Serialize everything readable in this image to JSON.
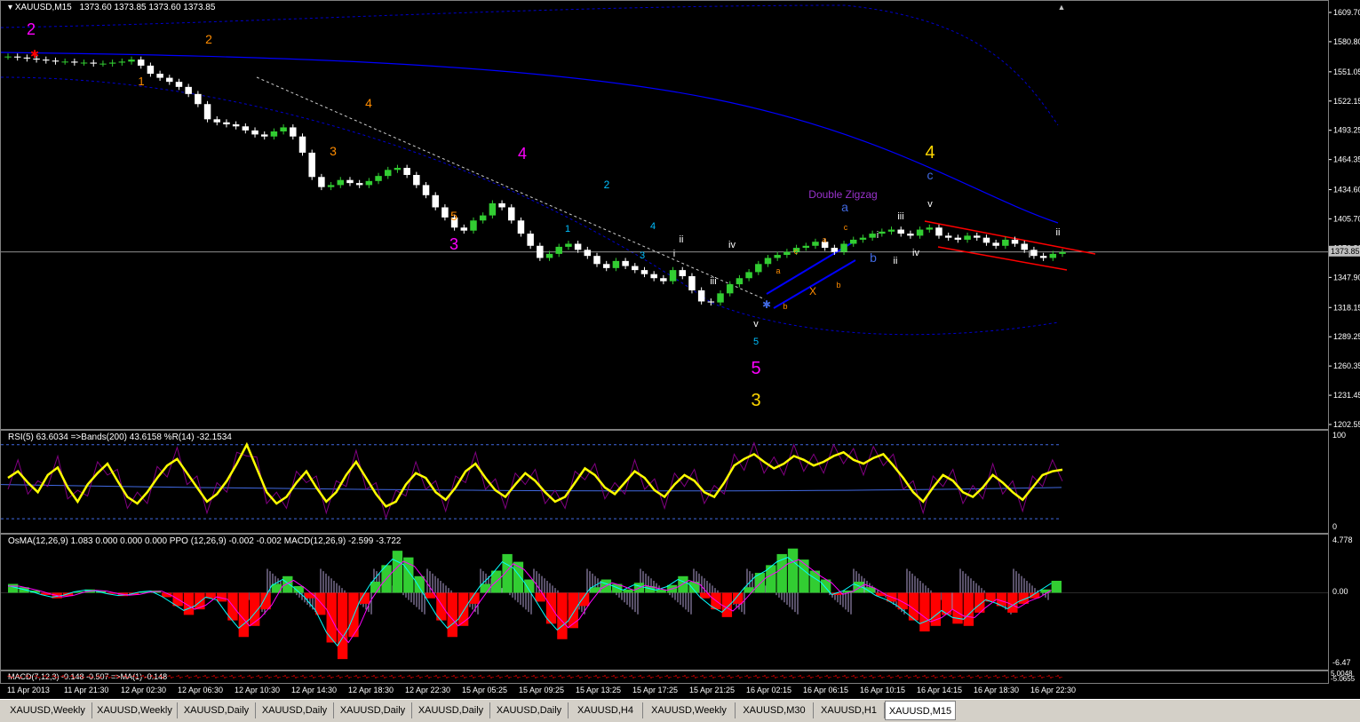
{
  "chart_data": [
    {
      "type": "candlestick",
      "symbol_title": "XAUUSD,M15",
      "ohlc_header": "1373.60 1373.85 1373.60 1373.85",
      "current_price_label": "1373.85",
      "ylim": [
        1202.55,
        1609.7
      ],
      "price_ticks": [
        "1609.70",
        "1580.80",
        "1551.05",
        "1522.15",
        "1493.25",
        "1464.35",
        "1434.60",
        "1405.70",
        "1376.80",
        "1347.90",
        "1318.15",
        "1289.25",
        "1260.35",
        "1231.45",
        "1202.55"
      ],
      "time_ticks": [
        "11 Apr 2013",
        "11 Apr 21:30",
        "12 Apr 02:30",
        "12 Apr 06:30",
        "12 Apr 10:30",
        "12 Apr 14:30",
        "12 Apr 18:30",
        "12 Apr 22:30",
        "15 Apr 05:25",
        "15 Apr 09:25",
        "15 Apr 13:25",
        "15 Apr 17:25",
        "15 Apr 21:25",
        "16 Apr 02:15",
        "16 Apr 06:15",
        "16 Apr 10:15",
        "16 Apr 14:15",
        "16 Apr 18:30",
        "16 Apr 22:30"
      ],
      "close_path": [
        1567,
        1566,
        1565,
        1564,
        1563,
        1562,
        1562,
        1561,
        1561,
        1560,
        1560,
        1561,
        1562,
        1564,
        1558,
        1550,
        1546,
        1542,
        1537,
        1530,
        1520,
        1505,
        1502,
        1500,
        1498,
        1494,
        1490,
        1488,
        1493,
        1497,
        1488,
        1472,
        1448,
        1438,
        1440,
        1445,
        1442,
        1440,
        1444,
        1449,
        1455,
        1457,
        1450,
        1440,
        1430,
        1418,
        1408,
        1398,
        1395,
        1405,
        1410,
        1422,
        1418,
        1405,
        1392,
        1380,
        1368,
        1372,
        1379,
        1382,
        1376,
        1370,
        1362,
        1358,
        1365,
        1360,
        1356,
        1352,
        1348,
        1345,
        1356,
        1350,
        1336,
        1325,
        1324,
        1333,
        1342,
        1348,
        1354,
        1362,
        1368,
        1371,
        1374,
        1378,
        1380,
        1384,
        1378,
        1374,
        1382,
        1386,
        1388,
        1392,
        1394,
        1396,
        1392,
        1390,
        1396,
        1398,
        1390,
        1388,
        1386,
        1390,
        1388,
        1383,
        1380,
        1386,
        1382,
        1376,
        1370,
        1368,
        1372,
        1373.85
      ],
      "current_price": 1373.85,
      "wave_labels": [
        {
          "text": "2",
          "color": "#ff00ff"
        },
        {
          "text": "2",
          "color": "#ff8c00"
        },
        {
          "text": "1",
          "color": "#ff8c00"
        },
        {
          "text": "4",
          "color": "#ff8c00"
        },
        {
          "text": "3",
          "color": "#ff8c00"
        },
        {
          "text": "5",
          "color": "#ff8c00"
        },
        {
          "text": "3",
          "color": "#ff00ff"
        },
        {
          "text": "4",
          "color": "#ff00ff"
        },
        {
          "text": "2",
          "color": "#00bfff"
        },
        {
          "text": "1",
          "color": "#00bfff"
        },
        {
          "text": "4",
          "color": "#00bfff"
        },
        {
          "text": "3",
          "color": "#00bfff"
        },
        {
          "text": "ii",
          "color": "#ffffff"
        },
        {
          "text": "i",
          "color": "#ffffff"
        },
        {
          "text": "iv",
          "color": "#ffffff"
        },
        {
          "text": "iii",
          "color": "#ffffff"
        },
        {
          "text": "v",
          "color": "#ffffff"
        },
        {
          "text": "5",
          "color": "#00bfff"
        },
        {
          "text": "5",
          "color": "#ff00ff"
        },
        {
          "text": "3",
          "color": "#ffd700"
        },
        {
          "text": "a",
          "color": "#ff8c00"
        },
        {
          "text": "b",
          "color": "#ff8c00"
        },
        {
          "text": "c",
          "color": "#ff8c00"
        },
        {
          "text": "X",
          "color": "#ff8c00"
        },
        {
          "text": "a",
          "color": "#ff8c00"
        },
        {
          "text": "b",
          "color": "#ff8c00"
        },
        {
          "text": "c",
          "color": "#ff8c00"
        },
        {
          "text": "a",
          "color": "#4169e1"
        },
        {
          "text": "Double Zigzag",
          "color": "#9932cc"
        },
        {
          "text": "b",
          "color": "#4169e1"
        },
        {
          "text": "i",
          "color": "#ffffff"
        },
        {
          "text": "ii",
          "color": "#ffffff"
        },
        {
          "text": "iii",
          "color": "#ffffff"
        },
        {
          "text": "iv",
          "color": "#ffffff"
        },
        {
          "text": "v",
          "color": "#ffffff"
        },
        {
          "text": "c",
          "color": "#4169e1"
        },
        {
          "text": "4",
          "color": "#ffd700"
        },
        {
          "text": "i",
          "color": "#ffffff"
        },
        {
          "text": "ii",
          "color": "#ffffff"
        }
      ]
    },
    {
      "type": "line",
      "title": "RSI(5) 63.6034  =>Bands(200) 43.6158  %R(14) -32.1534",
      "ylim": [
        0,
        100
      ],
      "y_ticks": [
        "100",
        "0"
      ],
      "rsi": [
        55,
        62,
        50,
        40,
        58,
        66,
        45,
        30,
        48,
        60,
        70,
        52,
        35,
        28,
        40,
        55,
        68,
        75,
        60,
        45,
        30,
        38,
        52,
        70,
        90,
        65,
        40,
        28,
        35,
        50,
        62,
        45,
        30,
        40,
        58,
        72,
        55,
        38,
        25,
        30,
        48,
        60,
        55,
        40,
        32,
        45,
        62,
        70,
        55,
        42,
        35,
        48,
        60,
        52,
        40,
        30,
        35,
        50,
        65,
        58,
        45,
        38,
        50,
        62,
        55,
        42,
        35,
        48,
        58,
        52,
        40,
        35,
        50,
        68,
        75,
        80,
        72,
        65,
        70,
        78,
        74,
        68,
        72,
        78,
        82,
        74,
        70,
        76,
        80,
        68,
        55,
        40,
        30,
        45,
        58,
        52,
        40,
        35,
        45,
        58,
        50,
        40,
        32,
        45,
        58,
        62,
        63.6
      ]
    },
    {
      "type": "bar",
      "title": "OsMA(12,26,9) 1.083 0.000 0.000 0.000  PPO (12,26,9) -0.002 -0.002  MACD(12,26,9) -2.599 -3.722",
      "ylim": [
        -6.47,
        4.778
      ],
      "y_ticks": [
        "4.778",
        "0.00",
        "-6.47"
      ],
      "osma": [
        0.8,
        0.5,
        0.2,
        -0.2,
        -0.5,
        -0.3,
        0.1,
        0.3,
        0.2,
        -0.1,
        -0.3,
        -0.2,
        0.1,
        0.2,
        -0.4,
        -1.2,
        -2.0,
        -1.5,
        -0.5,
        -0.8,
        -2.5,
        -4.0,
        -3.0,
        -1.5,
        0.8,
        1.5,
        0.6,
        -0.5,
        -2.0,
        -4.5,
        -6.0,
        -4.0,
        -1.0,
        1.0,
        2.5,
        3.8,
        3.2,
        1.5,
        -0.5,
        -2.5,
        -4.0,
        -3.0,
        -1.0,
        0.8,
        2.0,
        3.5,
        2.8,
        1.2,
        -0.8,
        -2.8,
        -4.2,
        -3.2,
        -1.2,
        0.5,
        1.2,
        0.8,
        0.3,
        0.9,
        0.6,
        0.3,
        0.7,
        1.5,
        1.0,
        -0.5,
        -1.5,
        -2.2,
        -1.0,
        0.5,
        1.8,
        2.5,
        3.5,
        4.0,
        3.0,
        2.0,
        1.2,
        -0.2,
        0.2,
        1.0,
        0.5,
        -0.3,
        -0.8,
        -1.5,
        -2.5,
        -3.5,
        -3.0,
        -2.0,
        -2.8,
        -3.0,
        -1.8,
        -0.8,
        -1.2,
        -1.8,
        -1.0,
        -0.5,
        0.3,
        1.083
      ]
    },
    {
      "type": "line",
      "title": "MACD(7,12,3) -0.148 -0.507  =>MA(1) -0.148",
      "y_ticks": [
        "5.0048",
        "-5.0655"
      ]
    }
  ],
  "tabs": [
    {
      "label": "XAUUSD,Weekly",
      "active": false
    },
    {
      "label": "XAUUSD,Weekly",
      "active": false
    },
    {
      "label": "XAUUSD,Daily",
      "active": false
    },
    {
      "label": "XAUUSD,Daily",
      "active": false
    },
    {
      "label": "XAUUSD,Daily",
      "active": false
    },
    {
      "label": "XAUUSD,Daily",
      "active": false
    },
    {
      "label": "XAUUSD,Daily",
      "active": false
    },
    {
      "label": "XAUUSD,H4",
      "active": false
    },
    {
      "label": "XAUUSD,Weekly",
      "active": false
    },
    {
      "label": "XAUUSD,M30",
      "active": false
    },
    {
      "label": "XAUUSD,H1",
      "active": false
    },
    {
      "label": "XAUUSD,M15",
      "active": true
    }
  ],
  "colors": {
    "bull_candle": "#32cd32",
    "bear_candle": "#ffffff",
    "ma_line": "#0000ff",
    "band_line": "#0000cd",
    "rsi_line": "#ffff00",
    "wpr_line": "#800080",
    "osma_up": "#32cd32",
    "osma_down": "#ff0000",
    "macd_line": "#00ffff",
    "signal_line": "#ff00ff",
    "channel_red": "#ff0000",
    "channel_blue": "#0000ff"
  }
}
